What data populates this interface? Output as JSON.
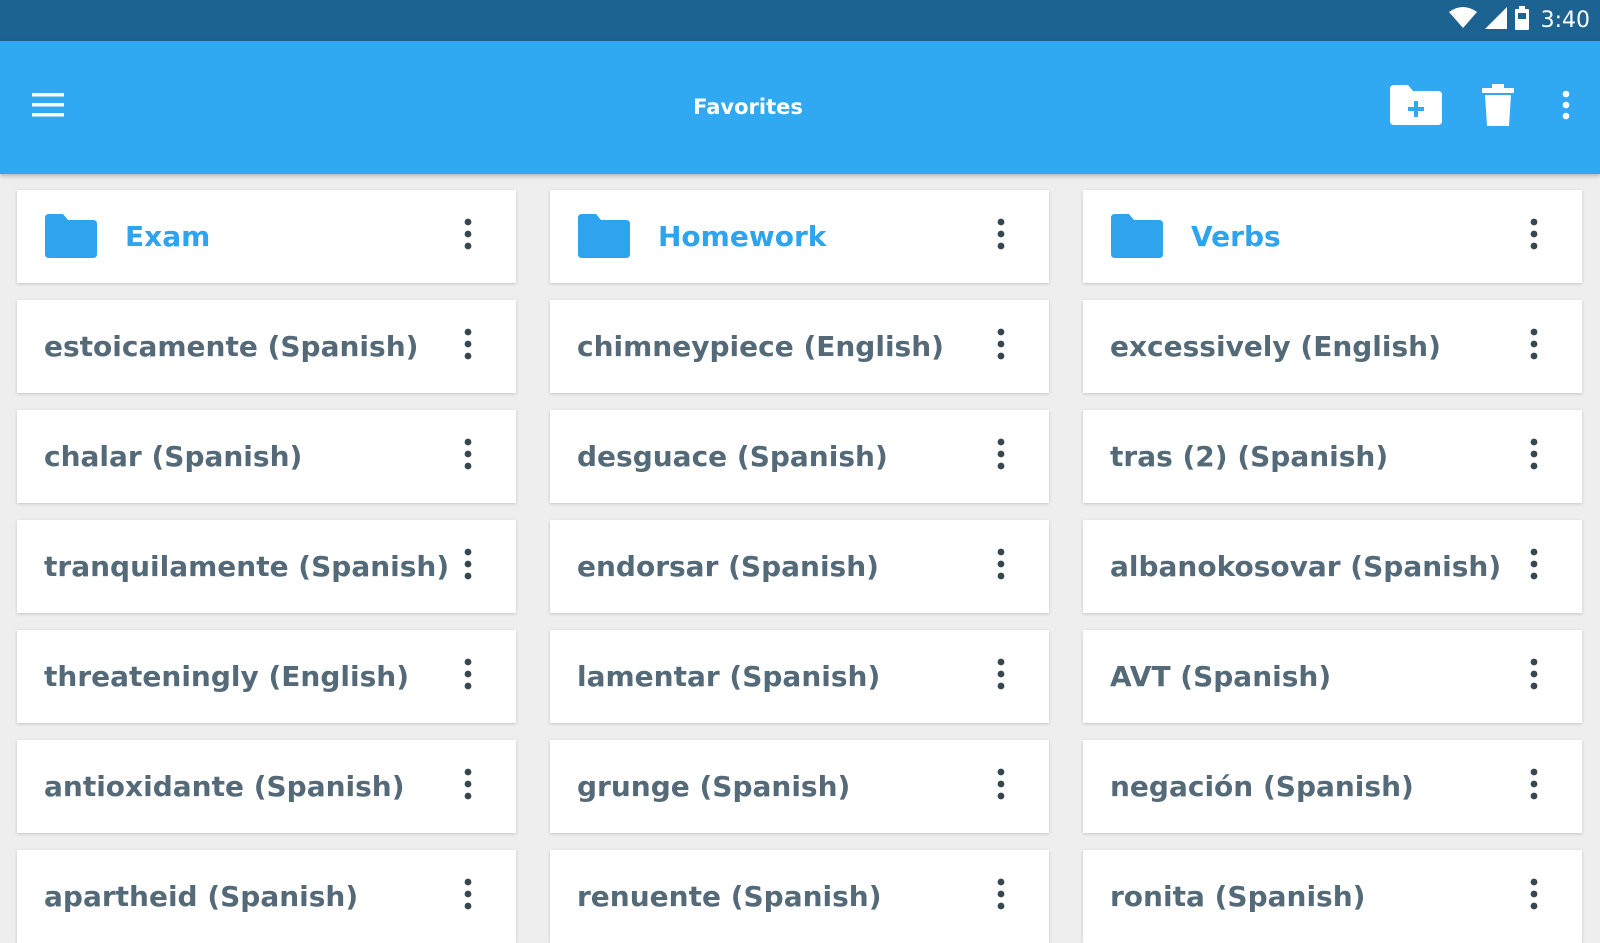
{
  "status_bar": {
    "time": "3:40",
    "icons": [
      "wifi-icon",
      "cell-signal-icon",
      "battery-icon"
    ]
  },
  "app_bar": {
    "title": "Favorites",
    "icons": [
      "hamburger-menu-icon",
      "new-folder-icon",
      "trash-icon",
      "more-vert-icon"
    ]
  },
  "colors": {
    "status_bar": "#1c6391",
    "app_bar": "#30a8f2",
    "accent": "#2ea3ee",
    "item_text": "#546a78",
    "background": "#eeeeee"
  },
  "folders": [
    {
      "name": "Exam"
    },
    {
      "name": "Homework"
    },
    {
      "name": "Verbs"
    }
  ],
  "favorites": [
    {
      "word": "estoicamente (Spanish)"
    },
    {
      "word": "chimneypiece (English)"
    },
    {
      "word": "excessively (English)"
    },
    {
      "word": "chalar (Spanish)"
    },
    {
      "word": "desguace (Spanish)"
    },
    {
      "word": "tras (2) (Spanish)"
    },
    {
      "word": "tranquilamente (Spanish)"
    },
    {
      "word": "endorsar (Spanish)"
    },
    {
      "word": "albanokosovar (Spanish)"
    },
    {
      "word": "threateningly (English)"
    },
    {
      "word": "lamentar (Spanish)"
    },
    {
      "word": "AVT (Spanish)"
    },
    {
      "word": "antioxidante (Spanish)"
    },
    {
      "word": "grunge (Spanish)"
    },
    {
      "word": "negación (Spanish)"
    },
    {
      "word": "apartheid (Spanish)"
    },
    {
      "word": "renuente (Spanish)"
    },
    {
      "word": "ronita (Spanish)"
    }
  ]
}
